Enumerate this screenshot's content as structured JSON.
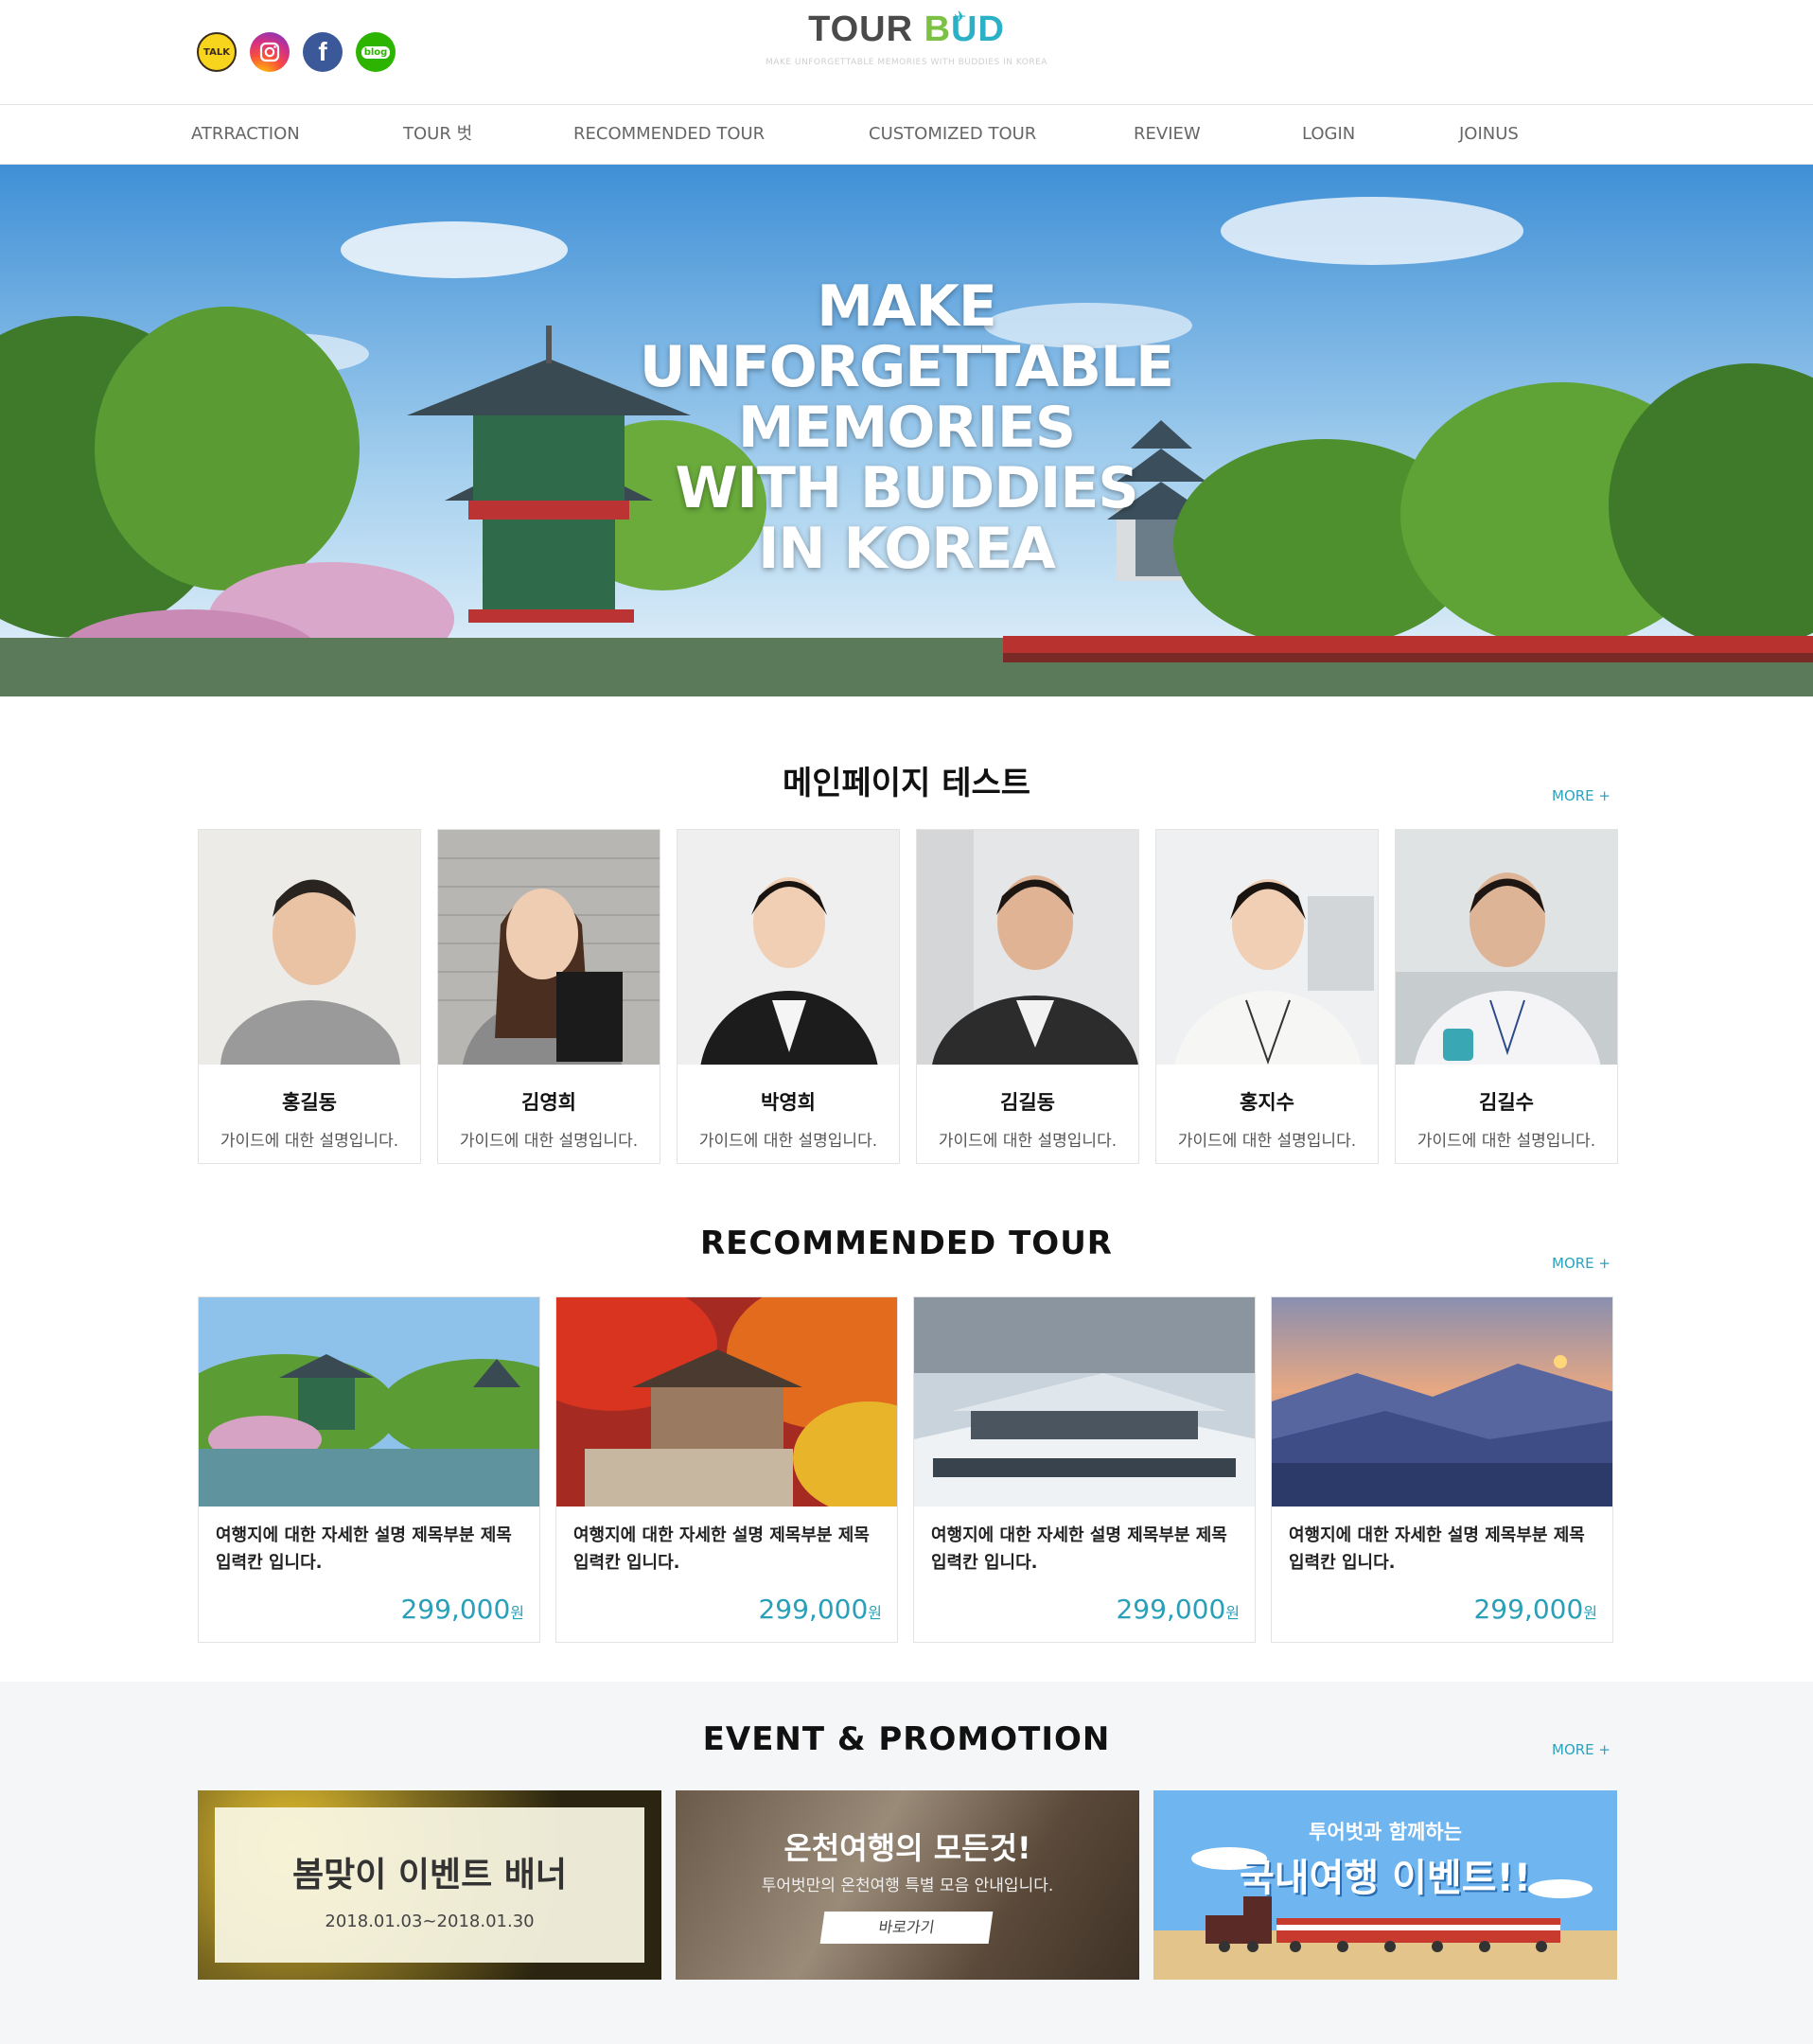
{
  "social": {
    "kakao": "TALK",
    "instagram_icon": "instagram-icon",
    "facebook": "f",
    "blog": "blog"
  },
  "logo": {
    "tour": "TOUR",
    "bud_b": "B",
    "bud_rest": "UD",
    "tagline": "MAKE UNFORGETTABLE MEMORIES WITH BUDDIES IN KOREA"
  },
  "nav": {
    "items": [
      "ATRRACTION",
      "TOUR 벗",
      "RECOMMENDED TOUR",
      "CUSTOMIZED TOUR",
      "REVIEW",
      "LOGIN",
      "JOINUS"
    ]
  },
  "hero": {
    "lines": [
      "MAKE",
      "UNFORGETTABLE",
      "MEMORIES",
      "WITH BUDDIES",
      "IN KOREA"
    ]
  },
  "guides_section": {
    "title": "메인페이지 테스트",
    "more": "MORE +",
    "guides": [
      {
        "name": "홍길동",
        "desc": "가이드에 대한 설명입니다."
      },
      {
        "name": "김영희",
        "desc": "가이드에 대한 설명입니다."
      },
      {
        "name": "박영희",
        "desc": "가이드에 대한 설명입니다."
      },
      {
        "name": "김길동",
        "desc": "가이드에 대한 설명입니다."
      },
      {
        "name": "홍지수",
        "desc": "가이드에 대한 설명입니다."
      },
      {
        "name": "김길수",
        "desc": "가이드에 대한 설명입니다."
      }
    ]
  },
  "tours_section": {
    "title": "RECOMMENDED TOUR",
    "more": "MORE +",
    "tours": [
      {
        "desc": "여행지에 대한 자세한 설명 제목부분 제목 입력칸 입니다.",
        "price": "299,000",
        "unit": "원"
      },
      {
        "desc": "여행지에 대한 자세한 설명 제목부분 제목 입력칸 입니다.",
        "price": "299,000",
        "unit": "원"
      },
      {
        "desc": "여행지에 대한 자세한 설명 제목부분 제목 입력칸 입니다.",
        "price": "299,000",
        "unit": "원"
      },
      {
        "desc": "여행지에 대한 자세한 설명 제목부분 제목 입력칸 입니다.",
        "price": "299,000",
        "unit": "원"
      }
    ]
  },
  "events_section": {
    "title": "EVENT & PROMOTION",
    "more": "MORE +",
    "event1": {
      "title": "봄맞이 이벤트 배너",
      "date": "2018.01.03~2018.01.30"
    },
    "event2": {
      "title": "온천여행의 모든것!",
      "sub": "투어벗만의 온천여행 특별 모음 안내입니다.",
      "button": "바로가기"
    },
    "event3": {
      "top": "투어벗과 함께하는",
      "title": "국내여행 이벤트!!"
    }
  },
  "colors": {
    "accent": "#2aa3bd",
    "logo_green": "#7bc142",
    "logo_blue": "#2bb0c5"
  }
}
